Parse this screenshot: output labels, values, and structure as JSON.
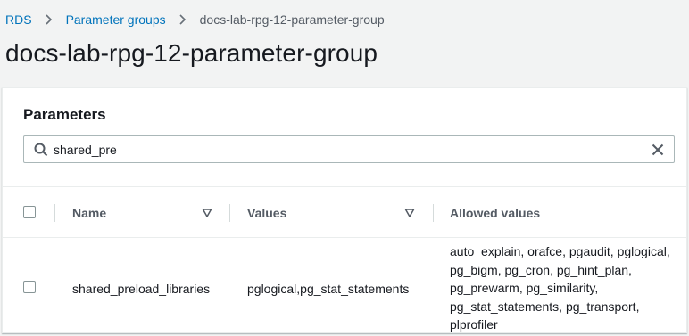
{
  "breadcrumb": {
    "items": [
      {
        "label": "RDS"
      },
      {
        "label": "Parameter groups"
      },
      {
        "label": "docs-lab-rpg-12-parameter-group"
      }
    ]
  },
  "page": {
    "title": "docs-lab-rpg-12-parameter-group"
  },
  "panel": {
    "title": "Parameters"
  },
  "search": {
    "value": "shared_pre",
    "placeholder": ""
  },
  "table": {
    "columns": [
      {
        "label": "Name"
      },
      {
        "label": "Values"
      },
      {
        "label": "Allowed values"
      }
    ],
    "rows": [
      {
        "name": "shared_preload_libraries",
        "values": "pglogical,pg_stat_statements",
        "allowed_lines": [
          "auto_explain, orafce, pgaudit, pglogical,",
          "pg_bigm, pg_cron, pg_hint_plan,",
          "pg_prewarm, pg_similarity,",
          "pg_stat_statements, pg_transport,",
          "plprofiler"
        ]
      }
    ]
  },
  "colors": {
    "link": "#0073bb",
    "background": "#f2f3f3",
    "text": "#16191f",
    "muted": "#545b64"
  }
}
